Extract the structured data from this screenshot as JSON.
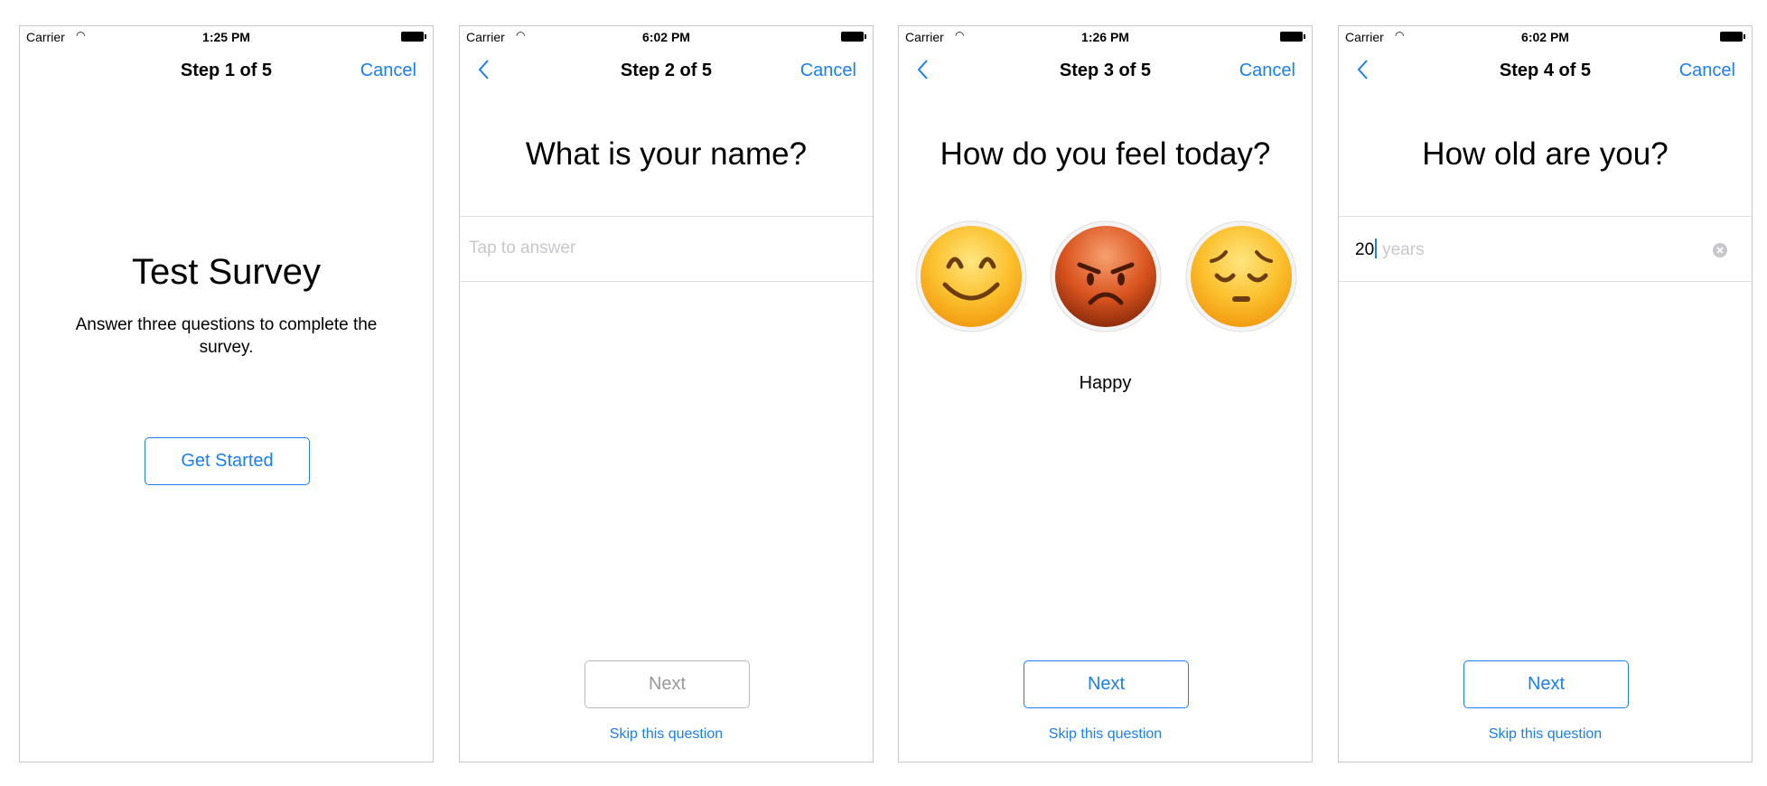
{
  "colors": {
    "accent": "#1a7ef5",
    "disabled": "#999999"
  },
  "screens": [
    {
      "status": {
        "carrier": "Carrier",
        "time": "1:25 PM"
      },
      "nav": {
        "title": "Step 1 of 5",
        "cancel": "Cancel"
      },
      "title": "Test Survey",
      "description": "Answer three questions to complete the survey.",
      "button": "Get Started"
    },
    {
      "status": {
        "carrier": "Carrier",
        "time": "6:02 PM"
      },
      "nav": {
        "title": "Step 2 of 5",
        "cancel": "Cancel"
      },
      "question": "What is your name?",
      "input": {
        "value": "",
        "placeholder": "Tap to answer"
      },
      "next": "Next",
      "next_enabled": false,
      "skip": "Skip this question"
    },
    {
      "status": {
        "carrier": "Carrier",
        "time": "1:26 PM"
      },
      "nav": {
        "title": "Step 3 of 5",
        "cancel": "Cancel"
      },
      "question": "How do you feel today?",
      "options": [
        "happy-face-icon",
        "angry-face-icon",
        "pensive-face-icon"
      ],
      "selected_label": "Happy",
      "next": "Next",
      "next_enabled": true,
      "skip": "Skip this question"
    },
    {
      "status": {
        "carrier": "Carrier",
        "time": "6:02 PM"
      },
      "nav": {
        "title": "Step 4 of 5",
        "cancel": "Cancel"
      },
      "question": "How old are you?",
      "input": {
        "value": "20",
        "unit": "years"
      },
      "next": "Next",
      "next_enabled": true,
      "skip": "Skip this question"
    }
  ]
}
